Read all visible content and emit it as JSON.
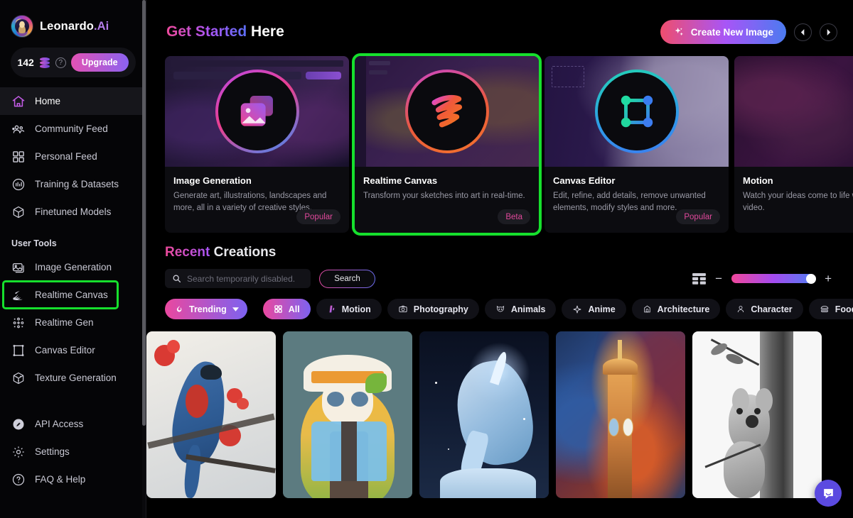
{
  "sidebar": {
    "brand": {
      "name": "Leonardo",
      "suffix": ".Ai",
      "logo_icon": "leonardo-avatar-icon"
    },
    "credits": {
      "count": "142",
      "coin_icon": "coins-icon",
      "help_icon": "question-circle-icon",
      "upgrade_label": "Upgrade"
    },
    "nav": [
      {
        "label": "Home",
        "icon": "home-icon",
        "active": true
      },
      {
        "label": "Community Feed",
        "icon": "community-icon",
        "active": false
      },
      {
        "label": "Personal Feed",
        "icon": "grid-icon",
        "active": false
      },
      {
        "label": "Training & Datasets",
        "icon": "training-icon",
        "active": false
      },
      {
        "label": "Finetuned Models",
        "icon": "cube-icon",
        "active": false
      }
    ],
    "section_title": "User Tools",
    "tools": [
      {
        "label": "Image Generation",
        "icon": "image-icon",
        "highlight": false
      },
      {
        "label": "Realtime Canvas",
        "icon": "realtime-canvas-icon",
        "highlight": true
      },
      {
        "label": "Realtime Gen",
        "icon": "realtime-gen-icon",
        "highlight": false
      },
      {
        "label": "Canvas Editor",
        "icon": "canvas-editor-icon",
        "highlight": false
      },
      {
        "label": "Texture Generation",
        "icon": "texture-icon",
        "highlight": false
      }
    ],
    "bottom": [
      {
        "label": "API Access",
        "icon": "key-icon"
      },
      {
        "label": "Settings",
        "icon": "gear-icon"
      },
      {
        "label": "FAQ & Help",
        "icon": "question-circle-icon"
      }
    ]
  },
  "header": {
    "title_grad": "Get Started",
    "title_plain": "Here",
    "create_button": {
      "label": "Create New Image",
      "icon": "sparkles-icon"
    },
    "prev_icon": "chevron-left-icon",
    "next_icon": "chevron-right-icon"
  },
  "feature_cards": [
    {
      "title": "Image Generation",
      "desc": "Generate art, illustrations, landscapes and more, all in a variety of creative styles.",
      "badge": "Popular",
      "icon": "photos-icon",
      "selected": false
    },
    {
      "title": "Realtime Canvas",
      "desc": "Transform your sketches into art in real-time.",
      "badge": "Beta",
      "icon": "brush-stroke-icon",
      "selected": true
    },
    {
      "title": "Canvas Editor",
      "desc": "Edit, refine, add details, remove unwanted elements, modify styles and more.",
      "badge": "Popular",
      "icon": "bounding-box-icon",
      "selected": false
    },
    {
      "title": "Motion",
      "desc": "Watch your ideas come to life with generative video.",
      "badge": "",
      "icon": "film-strip-icon",
      "selected": false
    }
  ],
  "recent": {
    "title_grad": "Recent",
    "title_plain": "Creations",
    "search": {
      "placeholder": "Search temporarily disabled.",
      "value": "",
      "icon": "search-icon",
      "button_label": "Search"
    },
    "controls": {
      "grid_icon": "grid-view-icon",
      "zoom_out": "−",
      "zoom_in": "+",
      "slider_value": "100"
    },
    "chips": [
      {
        "label": "Trending",
        "icon": "flame-icon",
        "style": "grad",
        "caret": "chevron-down-icon"
      },
      {
        "label": "All",
        "icon": "grid-icon",
        "style": "grad",
        "caret": ""
      },
      {
        "label": "Motion",
        "icon": "motion-icon",
        "style": "dark",
        "caret": ""
      },
      {
        "label": "Photography",
        "icon": "camera-icon",
        "style": "dark",
        "caret": ""
      },
      {
        "label": "Animals",
        "icon": "cat-icon",
        "style": "dark",
        "caret": ""
      },
      {
        "label": "Anime",
        "icon": "sparkle-star-icon",
        "style": "dark",
        "caret": ""
      },
      {
        "label": "Architecture",
        "icon": "building-icon",
        "style": "dark",
        "caret": ""
      },
      {
        "label": "Character",
        "icon": "person-icon",
        "style": "dark",
        "caret": ""
      },
      {
        "label": "Food",
        "icon": "burger-icon",
        "style": "dark",
        "caret": ""
      }
    ],
    "chips_next_icon": "chevron-right-icon",
    "gallery": [
      {
        "name": "blue-red-bird-on-blossom-branch"
      },
      {
        "name": "anime-girl-with-white-hat-sticker"
      },
      {
        "name": "icy-unicorn-rearing-at-night"
      },
      {
        "name": "clock-tower-mosaic-painting"
      },
      {
        "name": "koala-climbing-tree-monochrome"
      }
    ]
  },
  "widgets": {
    "intercom": {
      "icon": "chat-bubble-icon",
      "color": "#5b4ae0"
    }
  },
  "colors": {
    "accent_pink": "#ee4a9b",
    "accent_purple": "#a855f7",
    "accent_blue": "#4b7bf0",
    "highlight_green": "#16e02d",
    "background": "#000000",
    "sidebar_bg": "#050507"
  }
}
